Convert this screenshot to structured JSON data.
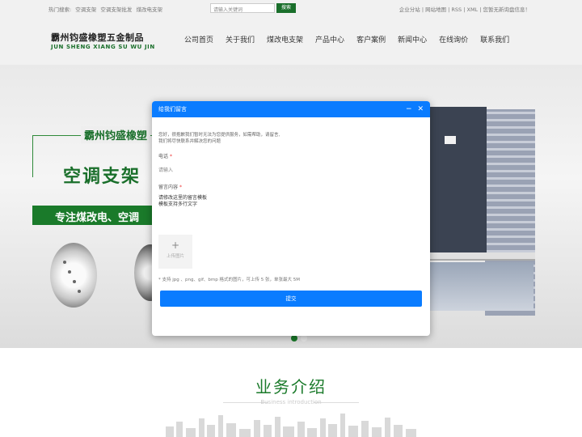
{
  "topbar": {
    "hot_label": "热门搜索:",
    "hot_terms": [
      "空调支架",
      "空调支架批发",
      "煤改电支架"
    ],
    "search_placeholder": "请输入关键词",
    "search_button": "搜索",
    "links": "企业分站 | 网站地图 | RSS | XML | 您暂无新询盘信息！"
  },
  "header": {
    "logo_cn": "霸州钧盛橡塑五金制品",
    "logo_en": "JUN SHENG XIANG SU WU JIN",
    "nav": [
      "公司首页",
      "关于我们",
      "煤改电支架",
      "产品中心",
      "客户案例",
      "新闻中心",
      "在线询价",
      "联系我们"
    ]
  },
  "banner": {
    "company": "霸州钧盛橡塑",
    "title": "空调支架",
    "slogan": "专注煤改电、空调"
  },
  "modal": {
    "title": "给我们留言",
    "minimize_icon": "−",
    "close_icon": "✕",
    "intro_line1": "您好，很抱歉我们暂时无法为您提供服务，如需帮助，请留言,",
    "intro_line2": "我们将尽快联系并解决您的问题",
    "phone_label": "电话",
    "required_mark": "*",
    "phone_placeholder": "请输入",
    "content_label": "留言内容",
    "content_line1": "请修改这里的留言模板",
    "content_line2": "模板支持多行文字",
    "upload_plus": "+",
    "upload_text": "上传图片",
    "upload_tip": "* 支持 jpg 、png、gif、bmp 格式的图片，可上传 5 张，单张最大 5M",
    "submit": "提交"
  },
  "business": {
    "title": "业务介绍",
    "subtitle": "Business introduction"
  },
  "colors": {
    "brand_green": "#1a7a2a",
    "modal_blue": "#0a7cff"
  }
}
